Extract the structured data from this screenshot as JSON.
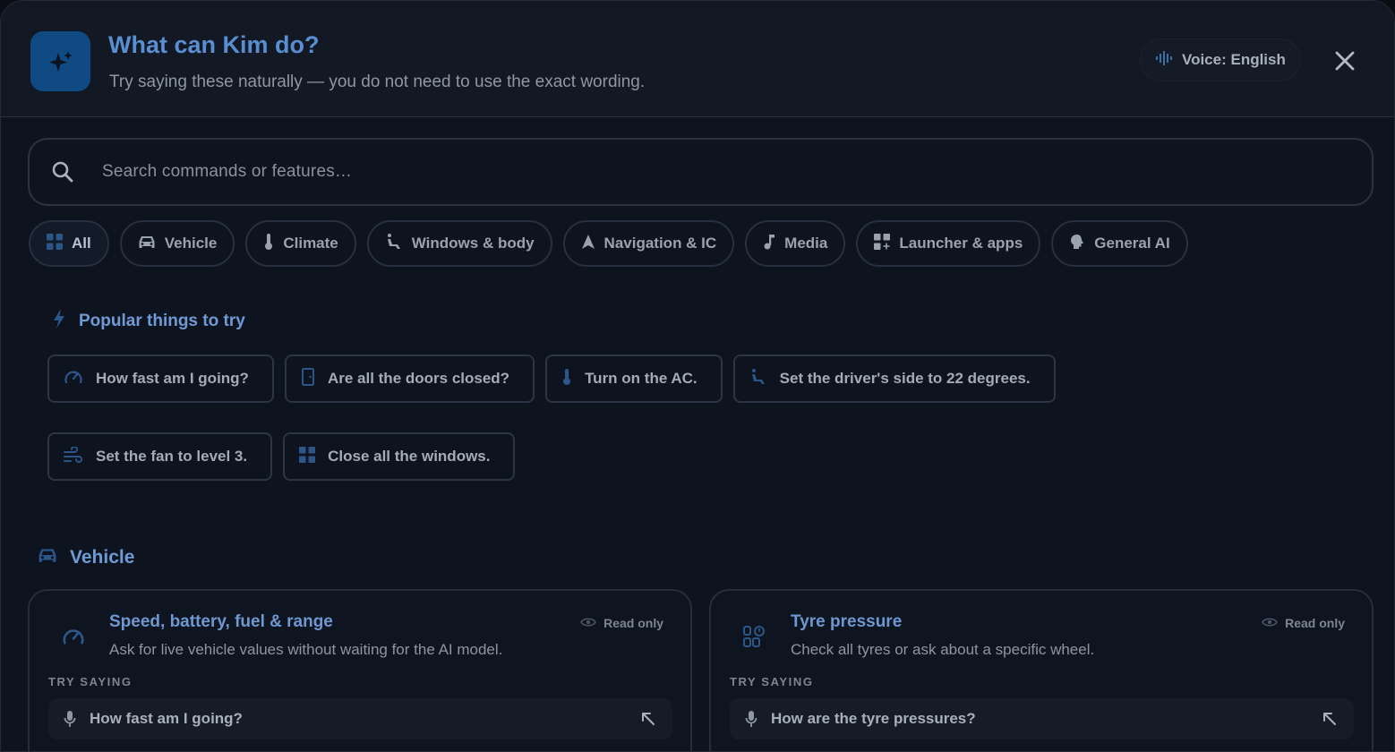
{
  "header": {
    "title": "What can Kim do?",
    "subtitle": "Try saying these naturally — you do not need to use the exact wording.",
    "voice_label": "Voice: English",
    "logo_icon": "sparkles-icon",
    "close_icon": "close-icon"
  },
  "search": {
    "placeholder": "Search commands or features…",
    "icon": "search-icon"
  },
  "categories": [
    {
      "label": "All",
      "icon": "grid-icon",
      "active": true
    },
    {
      "label": "Vehicle",
      "icon": "car-icon"
    },
    {
      "label": "Climate",
      "icon": "thermometer-icon"
    },
    {
      "label": "Windows & body",
      "icon": "seat-icon"
    },
    {
      "label": "Navigation & IC",
      "icon": "navigation-arrow-icon"
    },
    {
      "label": "Media",
      "icon": "music-note-icon"
    },
    {
      "label": "Launcher & apps",
      "icon": "apps-icon"
    },
    {
      "label": "General AI",
      "icon": "brain-icon"
    }
  ],
  "popular": {
    "title": "Popular things to try",
    "icon": "bolt-icon",
    "items": [
      {
        "label": "How fast am I going?",
        "icon": "speedometer-icon"
      },
      {
        "label": "Are all the doors closed?",
        "icon": "door-icon"
      },
      {
        "label": "Turn on the AC.",
        "icon": "thermometer-icon"
      },
      {
        "label": "Set the driver's side to 22 degrees.",
        "icon": "seat-icon"
      },
      {
        "label": "Set the fan to level 3.",
        "icon": "fan-icon"
      },
      {
        "label": "Close all the windows.",
        "icon": "window-icon"
      }
    ]
  },
  "vehicle_section": {
    "title": "Vehicle",
    "icon": "car-icon",
    "cards": [
      {
        "title": "Speed, battery, fuel & range",
        "description": "Ask for live vehicle values without waiting for the AI model.",
        "badge": "Read only",
        "try_label": "TRY SAYING",
        "example": "How fast am I going?",
        "icon": "speedometer-icon"
      },
      {
        "title": "Tyre pressure",
        "description": "Check all tyres or ask about a specific wheel.",
        "badge": "Read only",
        "try_label": "TRY SAYING",
        "example": "How are the tyre pressures?",
        "icon": "tyre-icon"
      }
    ]
  },
  "colors": {
    "accent": "#5a8ed0",
    "background": "#0e1320",
    "header": "#121824",
    "logo": "#0f4a82"
  }
}
